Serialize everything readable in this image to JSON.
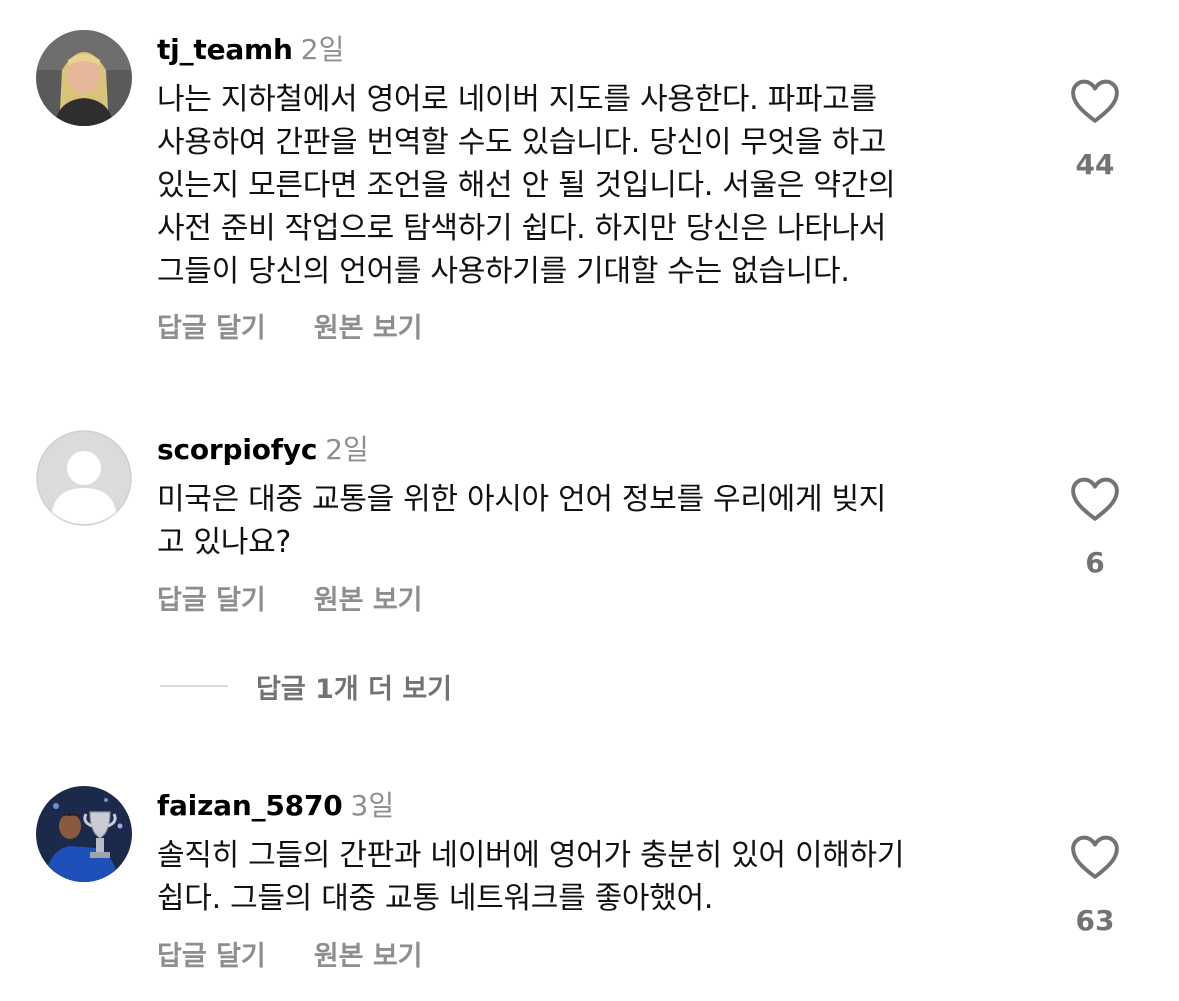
{
  "comments": [
    {
      "username": "tj_teamh",
      "time": "2일",
      "text": "나는 지하철에서 영어로 네이버 지도를 사용한다. 파파고를\n사용하여 간판을 번역할 수도 있습니다. 당신이 무엇을 하고\n있는지 모른다면 조언을 해선 안 될 것입니다. 서울은 약간의\n사전 준비 작업으로 탐색하기 쉽다. 하지만 당신은 나타나서\n그들이 당신의 언어를 사용하기를 기대할 수는 없습니다.",
      "reply_label": "답글 달기",
      "original_label": "원본 보기",
      "likes": "44"
    },
    {
      "username": "scorpiofyc",
      "time": "2일",
      "text": "미국은 대중 교통을 위한 아시아 언어 정보를 우리에게 빚지\n고 있나요?",
      "reply_label": "답글 달기",
      "original_label": "원본 보기",
      "likes": "6",
      "view_replies_label": "답글 1개 더 보기"
    },
    {
      "username": "faizan_5870",
      "time": "3일",
      "text": "솔직히 그들의 간판과 네이버에 영어가 충분히 있어 이해하기\n쉽다. 그들의 대중 교통 네트워크를 좋아했어.",
      "reply_label": "답글 달기",
      "original_label": "원본 보기",
      "likes": "63"
    }
  ],
  "icons": {
    "like": "heart-outline-icon"
  },
  "colors": {
    "secondary_text": "#8e8e8e",
    "username": "#000000",
    "divider": "#dbdbdb"
  }
}
